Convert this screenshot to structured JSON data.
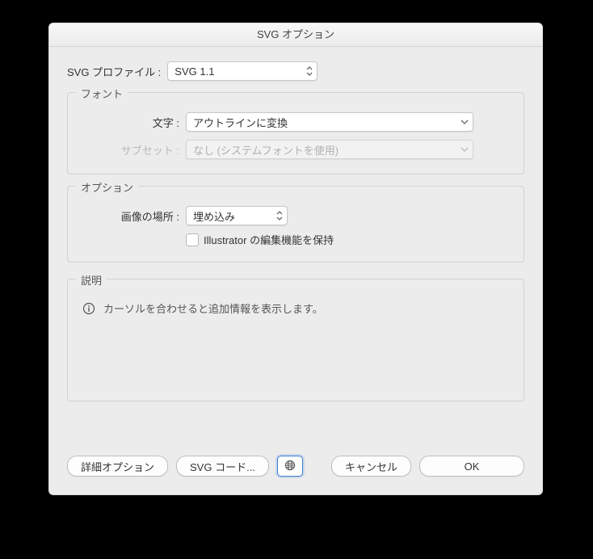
{
  "window": {
    "title": "SVG オプション"
  },
  "profile": {
    "label": "SVG プロファイル :",
    "value": "SVG 1.1"
  },
  "font_group": {
    "title": "フォント",
    "type_label": "文字 :",
    "type_value": "アウトラインに変換",
    "subset_label": "サブセット :",
    "subset_value": "なし (システムフォントを使用)"
  },
  "option_group": {
    "title": "オプション",
    "image_label": "画像の場所 :",
    "image_value": "埋め込み",
    "preserve_label": "Illustrator の編集機能を保持"
  },
  "description_group": {
    "title": "説明",
    "hint": "カーソルを合わせると追加情報を表示します。"
  },
  "buttons": {
    "more": "詳細オプション",
    "svg_code": "SVG コード...",
    "cancel": "キャンセル",
    "ok": "OK"
  }
}
